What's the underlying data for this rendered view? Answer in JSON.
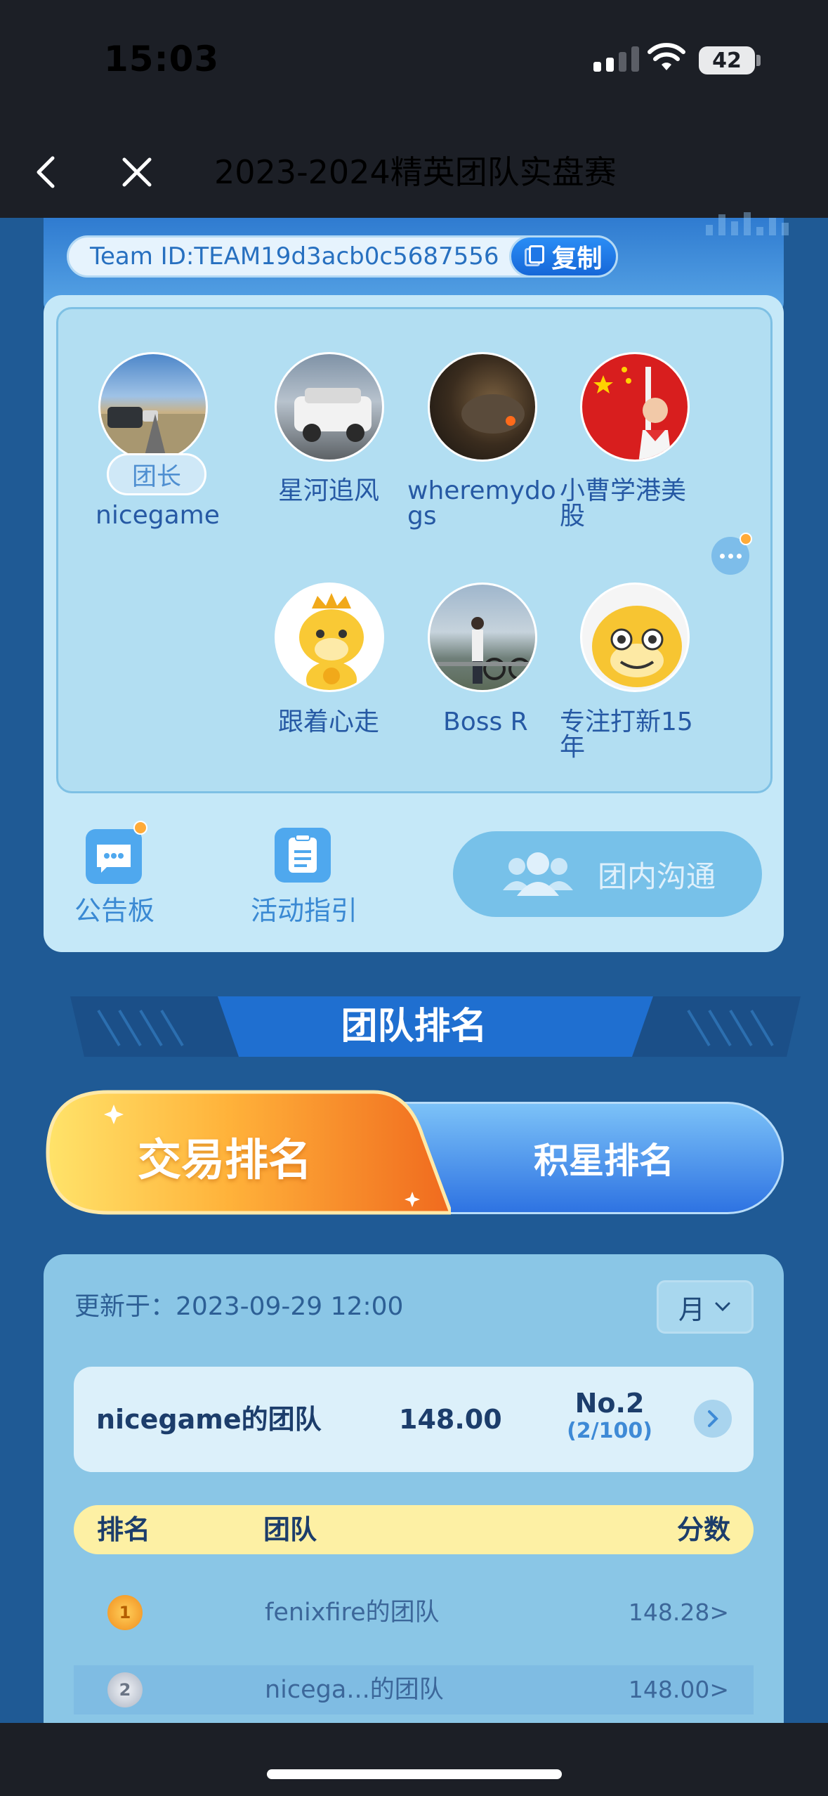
{
  "status": {
    "time": "15:03",
    "battery": "42"
  },
  "nav": {
    "title": "2023-2024精英团队实盘赛"
  },
  "team": {
    "team_id": "Team ID:TEAM19d3acb0c5687556",
    "copy_label": "复制",
    "leader_tag": "团长",
    "members": [
      {
        "name": "nicegame"
      },
      {
        "name": "星河追风"
      },
      {
        "name": "wheremydo\ngs"
      },
      {
        "name": "小曹学港美\n股"
      },
      {
        "name": "跟着心走"
      },
      {
        "name": "Boss R"
      },
      {
        "name": "专注打新15\n年"
      }
    ]
  },
  "tools": {
    "notice": "公告板",
    "guide": "活动指引",
    "chat": "团内沟通"
  },
  "ranking": {
    "section_title": "团队排名",
    "tab_trade": "交易排名",
    "tab_star": "积星排名",
    "updated": "更新于：2023-09-29 12:00",
    "period": "月",
    "my_team": {
      "name": "nicegame的团队",
      "score": "148.00",
      "rank": "No.2",
      "rank_sub": "(2/100)"
    },
    "headers": {
      "rank": "排名",
      "team": "团队",
      "score": "分数"
    },
    "rows": [
      {
        "rank": "1",
        "team": "fenixfire的团队",
        "score": "148.28>"
      },
      {
        "rank": "2",
        "team": "nicega...的团队",
        "score": "148.00>"
      }
    ]
  },
  "colors": {
    "accent": "#1667d8",
    "nav_bg": "#1c1f26",
    "page_bg": "#1f5a95"
  }
}
